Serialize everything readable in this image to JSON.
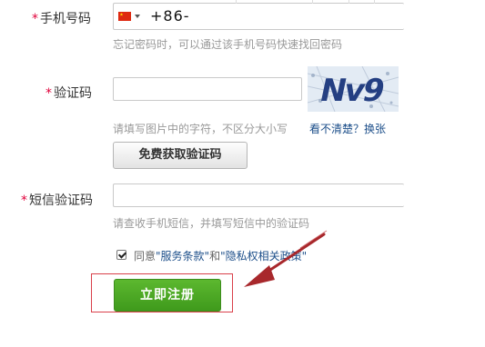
{
  "phone": {
    "label": "手机号码",
    "required_mark": "*",
    "country_code": "+86-",
    "hint": "忘记密码时，可以通过该手机号码快速找回密码"
  },
  "captcha": {
    "label": "验证码",
    "required_mark": "*",
    "value": "",
    "image_text": "Nv9",
    "hint": "请填写图片中的字符，不区分大小写",
    "refresh_link": "看不清楚？换张"
  },
  "sms": {
    "get_code_button": "免费获取验证码",
    "label": "短信验证码",
    "required_mark": "*",
    "value": "",
    "hint": "请查收手机短信，并填写短信中的验证码"
  },
  "agreement": {
    "checked": true,
    "prefix": "同意",
    "terms_link": "\"服务条款\"",
    "and": "和",
    "privacy_link": "\"隐私权相关政策\""
  },
  "submit": {
    "label": "立即注册"
  },
  "colors": {
    "required": "#e0003a",
    "link": "#1d4f8a",
    "register_button": "#4aa624",
    "annotation": "#b02a2e"
  }
}
